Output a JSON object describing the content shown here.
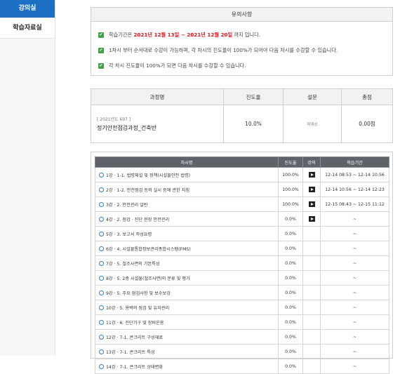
{
  "sidebar": {
    "items": [
      {
        "label": "강의실"
      },
      {
        "label": "학습자료실"
      }
    ]
  },
  "notice": {
    "title": "유의사항",
    "line1": {
      "prefix": "학습기간은 ",
      "highlight": "2021년 12월 13일 ~ 2021년 12월 20일",
      "suffix": " 까지 입니다."
    },
    "line2": "1차시 부터 순서대로 수강이 가능하며, 각 차시의 진도율이 100%가 되어야 다음 차시를 수강할 수 있습니다.",
    "line3": "각 차시 진도율이 100%가 되면 다음 차시를 수강할 수 있습니다."
  },
  "course": {
    "headers": [
      "과정명",
      "진도율",
      "설문",
      "총점"
    ],
    "code": "[ 2021년도 697 ]",
    "name": "정기안전점검과정_건축반",
    "progress": "10.0%",
    "survey": "미대상",
    "score": "0.00점"
  },
  "lessons": {
    "headers": [
      "차시명",
      "진도율",
      "강의",
      "학습기간"
    ],
    "rows": [
      {
        "title": "1강 · 1-1. 법령체설 및 정책(시설물안전 법령)",
        "progress": "100.0%",
        "play": true,
        "period": "12-14 08:53 ~ 12-14 10:56"
      },
      {
        "title": "2강 · 1-2. 안전점검 등의 실시 등에 관한 지침",
        "progress": "100.0%",
        "play": true,
        "period": "12-14 10:56 ~ 12-14 12:23"
      },
      {
        "title": "3강 · 2. 안전관리 일반",
        "progress": "100.0%",
        "play": true,
        "period": "12-15 08:43 ~ 12-15 11:12"
      },
      {
        "title": "4강 · 2. 점검 · 진단 현장 안전관리",
        "progress": "0.0%",
        "play": true,
        "period": "~"
      },
      {
        "title": "5강 · 3. 보고서 작성요령",
        "progress": "0.0%",
        "play": false,
        "period": "~"
      },
      {
        "title": "6강 · 4. 시설물통합정보관리종합시스템(FMS)",
        "progress": "0.0%",
        "play": false,
        "period": "~"
      },
      {
        "title": "7강 · 5. 철조사면의 기본특성",
        "progress": "0.0%",
        "play": false,
        "period": "~"
      },
      {
        "title": "8강 · 5. 2종 시설물(철조사면)의 분류 및 평가",
        "progress": "0.0%",
        "play": false,
        "period": "~"
      },
      {
        "title": "9강 · 5. 주요 점검사항 및 보수보강",
        "progress": "0.0%",
        "play": false,
        "period": "~"
      },
      {
        "title": "10강 · 5. 용벽의 점검 및 유지관리",
        "progress": "0.0%",
        "play": false,
        "period": "~"
      },
      {
        "title": "11강 · 6. 진단기구 및 장비운용",
        "progress": "0.0%",
        "play": false,
        "period": "~"
      },
      {
        "title": "12강 · 7-1. 콘크리트 구성재료",
        "progress": "0.0%",
        "play": false,
        "period": "~"
      },
      {
        "title": "13강 · 7-1. 콘크리트 특성",
        "progress": "0.0%",
        "play": false,
        "period": "~"
      },
      {
        "title": "14강 · 7-1. 콘크리트 상태변화",
        "progress": "0.0%",
        "play": false,
        "period": "~"
      }
    ]
  }
}
